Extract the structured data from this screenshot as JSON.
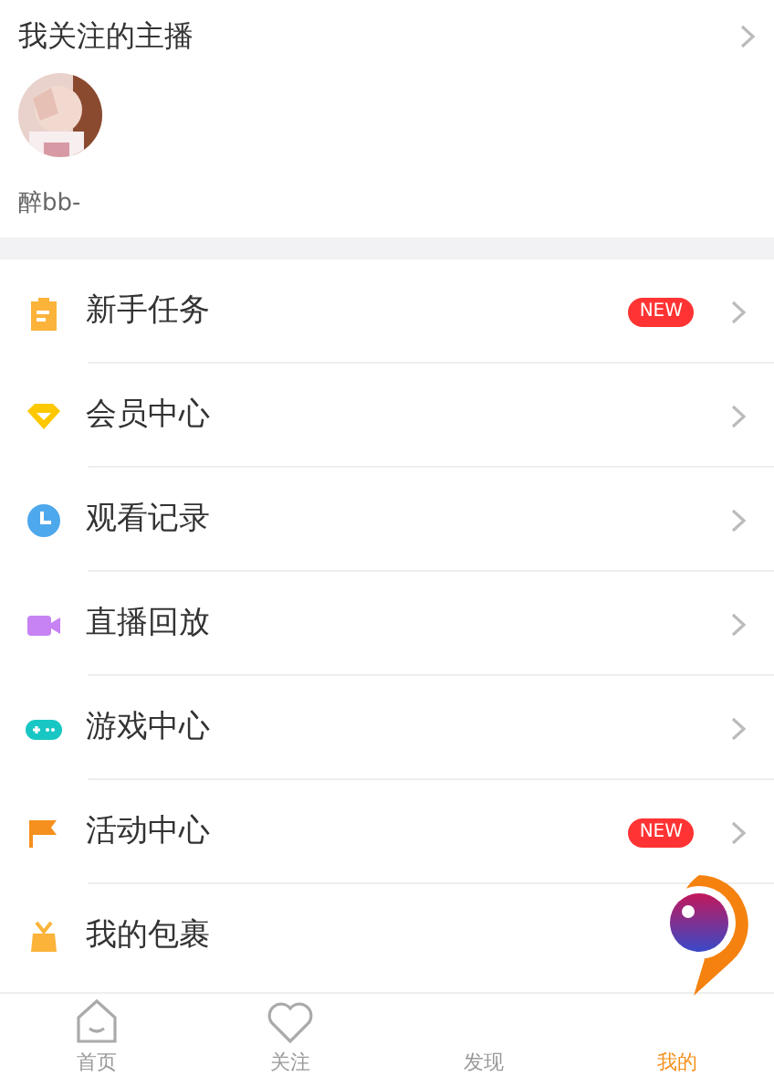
{
  "followed": {
    "title": "我关注的主播",
    "anchors": [
      {
        "kind": "picture",
        "name": "醉bb-"
      }
    ]
  },
  "menu": [
    {
      "label": "新手任务",
      "badge": "NEW"
    },
    {
      "label": "会员中心"
    },
    {
      "label": "观看记录"
    },
    {
      "label": "直播回放"
    },
    {
      "label": "游戏中心"
    },
    {
      "label": "活动中心",
      "badge": "NEW"
    },
    {
      "label": "我的包裹"
    }
  ],
  "tabs": [
    {
      "label": "首页",
      "selected": false
    },
    {
      "label": "关注",
      "selected": false
    },
    {
      "label": "发现",
      "selected": false
    },
    {
      "label": "我的",
      "selected": true
    }
  ]
}
